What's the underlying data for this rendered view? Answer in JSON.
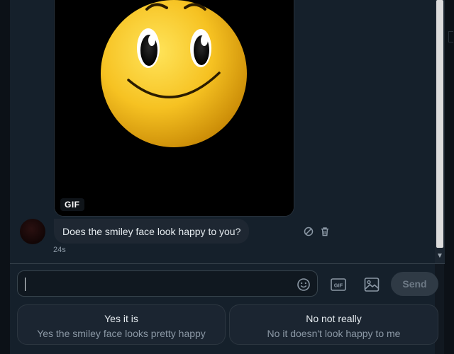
{
  "conversation": {
    "gif_badge": "GIF",
    "message_text": "Does the smiley face look happy to you?",
    "message_time": "24s"
  },
  "composer": {
    "input_value": "",
    "placeholder": "",
    "send_label": "Send"
  },
  "quick_replies": [
    {
      "title": "Yes it is",
      "subtitle": "Yes the smiley face looks pretty happy"
    },
    {
      "title": "No not really",
      "subtitle": "No it doesn't look happy to me"
    }
  ],
  "icons": {
    "emoji": "emoji-icon",
    "gif": "gif-icon",
    "image": "image-icon",
    "block": "block-icon",
    "delete": "trash-icon",
    "scroll_down": "chevron-down-icon"
  },
  "colors": {
    "background": "#15202b",
    "bubble": "#1e2732",
    "accent": "#1d9bf0",
    "send_disabled": "#2f3a45"
  }
}
